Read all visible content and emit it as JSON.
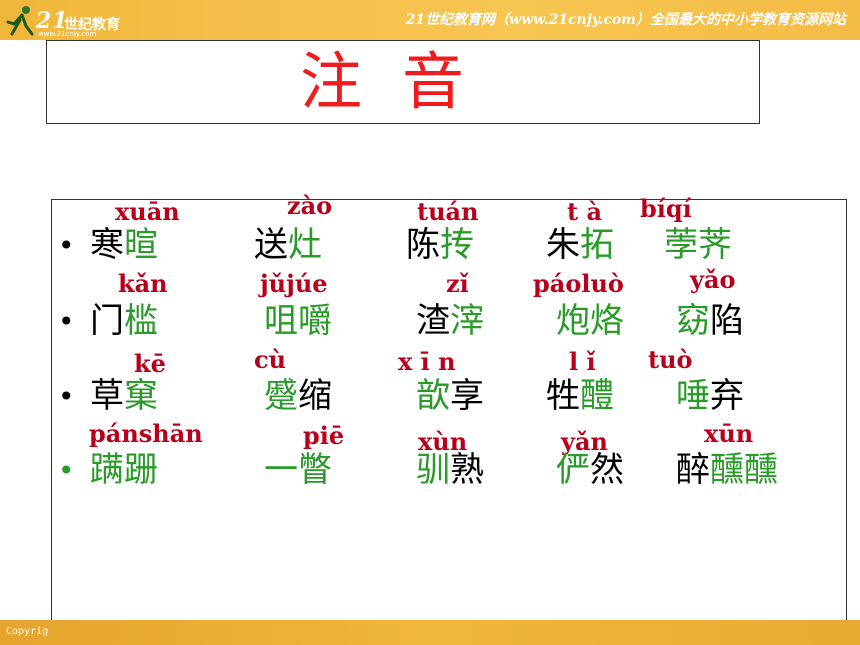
{
  "header": {
    "logo_num": "21",
    "logo_cn": "世纪教育",
    "logo_url": "www.21cnjy.com",
    "slogan": "21世纪教育网（www.21cnjy.com）全国最大的中小学教育资源网站"
  },
  "footer": {
    "copyright": "Copyrig"
  },
  "title": "注音",
  "colors": {
    "pinyin": "#b8001b",
    "highlight": "#2a9a2a",
    "title": "#ee1c1c",
    "header": "#f0b63a"
  },
  "bullet_char": "•",
  "rows": [
    {
      "pinyin": [
        "xuān",
        "zào",
        "tuán",
        "t à",
        "bíqí"
      ],
      "words": [
        {
          "normal_before": "寒",
          "green": "暄",
          "normal_after": ""
        },
        {
          "normal_before": "送",
          "green": "灶",
          "normal_after": ""
        },
        {
          "normal_before": "陈",
          "green": "抟",
          "normal_after": ""
        },
        {
          "normal_before": "朱",
          "green": "拓",
          "normal_after": ""
        },
        {
          "normal_before": "",
          "green": "荸荠",
          "normal_after": ""
        }
      ]
    },
    {
      "pinyin": [
        "kǎn",
        "jǔjúe",
        "zǐ",
        "páoluò",
        "yǎo"
      ],
      "words": [
        {
          "normal_before": "门",
          "green": "槛",
          "normal_after": ""
        },
        {
          "normal_before": "",
          "green": "咀嚼",
          "normal_after": ""
        },
        {
          "normal_before": "渣",
          "green": "滓",
          "normal_after": ""
        },
        {
          "normal_before": "",
          "green": "炮烙",
          "normal_after": ""
        },
        {
          "normal_before": "",
          "green": "窈",
          "normal_after": "陷"
        }
      ]
    },
    {
      "pinyin": [
        "kē",
        "cù",
        "x ī n",
        "l ǐ",
        "tuò"
      ],
      "words": [
        {
          "normal_before": "草",
          "green": "窠",
          "normal_after": ""
        },
        {
          "normal_before": "",
          "green": "蹙",
          "normal_after": "缩"
        },
        {
          "normal_before": "",
          "green": "歆",
          "normal_after": "享"
        },
        {
          "normal_before": "牲",
          "green": "醴",
          "normal_after": ""
        },
        {
          "normal_before": "",
          "green": "唾",
          "normal_after": "弃"
        }
      ]
    },
    {
      "pinyin": [
        "pánshān",
        "piē",
        "xùn",
        "yǎn",
        "xūn"
      ],
      "words": [
        {
          "normal_before": "",
          "green": "蹒跚",
          "normal_after": ""
        },
        {
          "normal_before": "",
          "green": "一瞥",
          "normal_after": ""
        },
        {
          "normal_before": "",
          "green": "驯",
          "normal_after": "熟"
        },
        {
          "normal_before": "",
          "green": "俨",
          "normal_after": "然"
        },
        {
          "normal_before": "醉",
          "green": "醺醺",
          "normal_after": ""
        }
      ]
    }
  ]
}
